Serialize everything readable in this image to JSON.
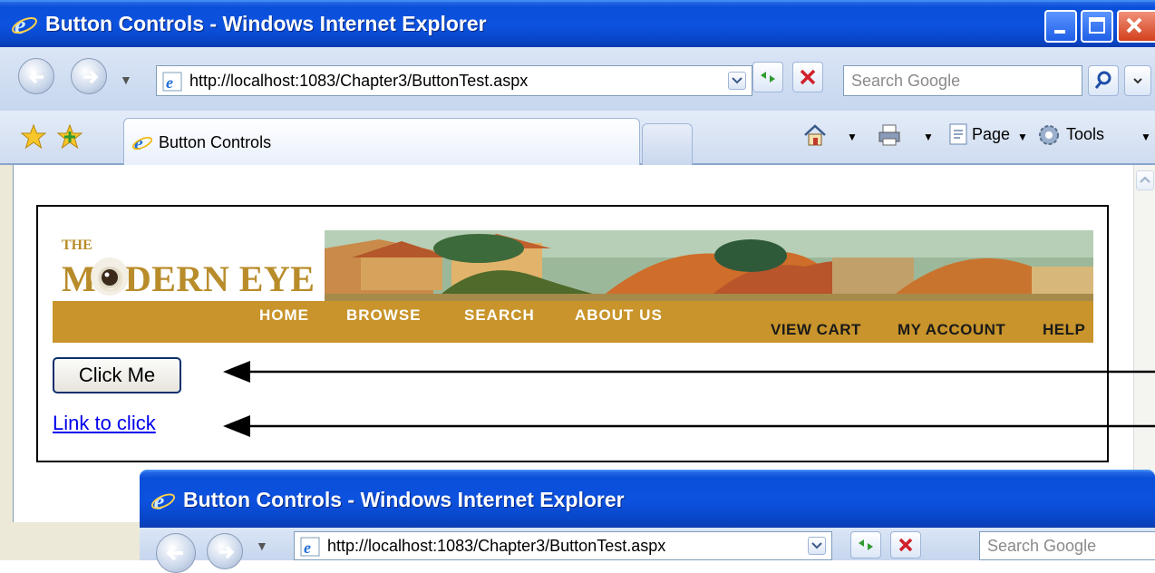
{
  "window": {
    "title": "Button Controls - Windows Internet Explorer"
  },
  "address_bar": {
    "url": "http://localhost:1083/Chapter3/ButtonTest.aspx"
  },
  "search": {
    "placeholder": "Search Google"
  },
  "tab": {
    "label": "Button Controls"
  },
  "command_bar": {
    "page_label": "Page",
    "tools_label": "Tools"
  },
  "banner": {
    "logo_the": "THE",
    "logo_name": "MODERN EYE",
    "nav_left": [
      "HOME",
      "BROWSE",
      "SEARCH",
      "ABOUT US"
    ],
    "nav_right": [
      "VIEW CART",
      "MY ACCOUNT",
      "HELP"
    ]
  },
  "content": {
    "button_label": "Click Me",
    "link_label": "Link to click"
  },
  "second_window": {
    "title": "Button Controls - Windows Internet Explorer",
    "url": "http://localhost:1083/Chapter3/ButtonTest.aspx",
    "search_placeholder": "Search Google"
  },
  "colors": {
    "titlebar": "#0c52e0",
    "nav_band": "#c8942b",
    "logo": "#b88c2a",
    "link": "#0000ee"
  }
}
